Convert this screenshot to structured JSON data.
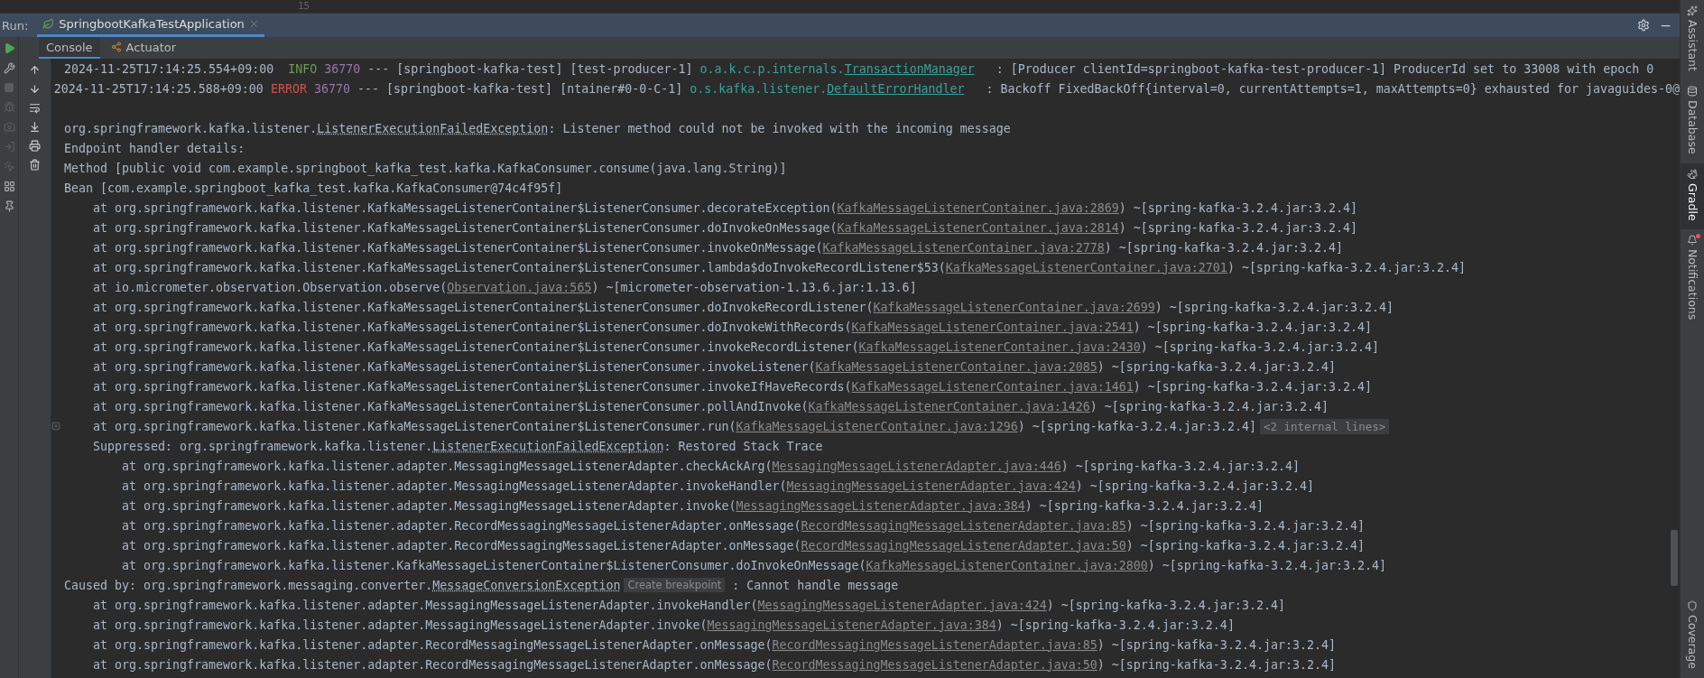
{
  "editor": {
    "line_number": "15"
  },
  "run_panel": {
    "label": "Run:",
    "tabs": [
      {
        "title": "SpringbootKafkaTestApplication",
        "selected": true
      }
    ]
  },
  "sub_tabs": [
    {
      "label": "Console",
      "selected": true
    },
    {
      "label": "Actuator",
      "selected": false
    }
  ],
  "right_toolbar": [
    {
      "label": "Assistant",
      "selected": false
    },
    {
      "label": "Database",
      "selected": false
    },
    {
      "label": "Gradle",
      "selected": true
    },
    {
      "label": "Notifications",
      "selected": false,
      "badge": true
    },
    {
      "label": "Coverage",
      "selected": false
    }
  ],
  "console": {
    "lines": [
      {
        "kind": "log",
        "segments": [
          {
            "kind": "text",
            "text": "2024-11-25T17:14:25.554+09:00  "
          },
          {
            "kind": "level-info",
            "text": "INFO"
          },
          {
            "kind": "pid",
            "text": " 36770"
          },
          {
            "kind": "text",
            "text": " --- [springboot-kafka-test] [test-producer-1] "
          },
          {
            "kind": "logger",
            "text": "o.a.k.c.p.internals."
          },
          {
            "kind": "class-link",
            "text": "TransactionManager"
          },
          {
            "kind": "text",
            "text": "   : [Producer clientId=springboot-kafka-test-producer-1] ProducerId set to 33008 with epoch 0"
          }
        ]
      },
      {
        "kind": "log",
        "segments": [
          {
            "kind": "text",
            "text": "2024-11-25T17:14:25.588+09:00 "
          },
          {
            "kind": "level-error",
            "text": "ERROR"
          },
          {
            "kind": "pid",
            "text": " 36770"
          },
          {
            "kind": "text",
            "text": " --- [springboot-kafka-test] [ntainer#0-0-C-1] "
          },
          {
            "kind": "logger",
            "text": "o.s.kafka.listener."
          },
          {
            "kind": "class-link",
            "text": "DefaultErrorHandler"
          },
          {
            "kind": "text",
            "text": "   : Backoff FixedBackOff{interval=0, currentAttempts=1, maxAttempts=0} exhausted for javaguides-0@"
          }
        ]
      },
      {
        "kind": "blank"
      },
      {
        "kind": "log",
        "segments": [
          {
            "kind": "text",
            "text": "org.springframework.kafka.listener."
          },
          {
            "kind": "type-link",
            "text": "ListenerExecutionFailedException"
          },
          {
            "kind": "text",
            "text": ": Listener method could not be invoked with the incoming message"
          }
        ]
      },
      {
        "kind": "log",
        "segments": [
          {
            "kind": "text",
            "text": "Endpoint handler details:"
          }
        ]
      },
      {
        "kind": "log",
        "segments": [
          {
            "kind": "text",
            "text": "Method [public void com.example.springboot_kafka_test.kafka.KafkaConsumer.consume(java.lang.String)]"
          }
        ]
      },
      {
        "kind": "log",
        "segments": [
          {
            "kind": "text",
            "text": "Bean [com.example.springboot_kafka_test.kafka.KafkaConsumer@74c4f95f]"
          }
        ]
      },
      {
        "kind": "frame",
        "segments": [
          {
            "kind": "text",
            "text": "at org.springframework.kafka.listener.KafkaMessageListenerContainer$ListenerConsumer.decorateException("
          },
          {
            "kind": "file-link",
            "text": "KafkaMessageListenerContainer.java:2869"
          },
          {
            "kind": "text",
            "text": ") ~[spring-kafka-3.2.4.jar:3.2.4]"
          }
        ]
      },
      {
        "kind": "frame",
        "segments": [
          {
            "kind": "text",
            "text": "at org.springframework.kafka.listener.KafkaMessageListenerContainer$ListenerConsumer.doInvokeOnMessage("
          },
          {
            "kind": "file-link",
            "text": "KafkaMessageListenerContainer.java:2814"
          },
          {
            "kind": "text",
            "text": ") ~[spring-kafka-3.2.4.jar:3.2.4]"
          }
        ]
      },
      {
        "kind": "frame",
        "segments": [
          {
            "kind": "text",
            "text": "at org.springframework.kafka.listener.KafkaMessageListenerContainer$ListenerConsumer.invokeOnMessage("
          },
          {
            "kind": "file-link",
            "text": "KafkaMessageListenerContainer.java:2778"
          },
          {
            "kind": "text",
            "text": ") ~[spring-kafka-3.2.4.jar:3.2.4]"
          }
        ]
      },
      {
        "kind": "frame",
        "segments": [
          {
            "kind": "text",
            "text": "at org.springframework.kafka.listener.KafkaMessageListenerContainer$ListenerConsumer.lambda$doInvokeRecordListener$53("
          },
          {
            "kind": "file-link",
            "text": "KafkaMessageListenerContainer.java:2701"
          },
          {
            "kind": "text",
            "text": ") ~[spring-kafka-3.2.4.jar:3.2.4]"
          }
        ]
      },
      {
        "kind": "frame",
        "segments": [
          {
            "kind": "text",
            "text": "at io.micrometer.observation.Observation.observe("
          },
          {
            "kind": "file-link",
            "text": "Observation.java:565"
          },
          {
            "kind": "text",
            "text": ") ~[micrometer-observation-1.13.6.jar:1.13.6]"
          }
        ]
      },
      {
        "kind": "frame",
        "segments": [
          {
            "kind": "text",
            "text": "at org.springframework.kafka.listener.KafkaMessageListenerContainer$ListenerConsumer.doInvokeRecordListener("
          },
          {
            "kind": "file-link",
            "text": "KafkaMessageListenerContainer.java:2699"
          },
          {
            "kind": "text",
            "text": ") ~[spring-kafka-3.2.4.jar:3.2.4]"
          }
        ]
      },
      {
        "kind": "frame",
        "segments": [
          {
            "kind": "text",
            "text": "at org.springframework.kafka.listener.KafkaMessageListenerContainer$ListenerConsumer.doInvokeWithRecords("
          },
          {
            "kind": "file-link",
            "text": "KafkaMessageListenerContainer.java:2541"
          },
          {
            "kind": "text",
            "text": ") ~[spring-kafka-3.2.4.jar:3.2.4]"
          }
        ]
      },
      {
        "kind": "frame",
        "segments": [
          {
            "kind": "text",
            "text": "at org.springframework.kafka.listener.KafkaMessageListenerContainer$ListenerConsumer.invokeRecordListener("
          },
          {
            "kind": "file-link",
            "text": "KafkaMessageListenerContainer.java:2430"
          },
          {
            "kind": "text",
            "text": ") ~[spring-kafka-3.2.4.jar:3.2.4]"
          }
        ]
      },
      {
        "kind": "frame",
        "segments": [
          {
            "kind": "text",
            "text": "at org.springframework.kafka.listener.KafkaMessageListenerContainer$ListenerConsumer.invokeListener("
          },
          {
            "kind": "file-link",
            "text": "KafkaMessageListenerContainer.java:2085"
          },
          {
            "kind": "text",
            "text": ") ~[spring-kafka-3.2.4.jar:3.2.4]"
          }
        ]
      },
      {
        "kind": "frame",
        "segments": [
          {
            "kind": "text",
            "text": "at org.springframework.kafka.listener.KafkaMessageListenerContainer$ListenerConsumer.invokeIfHaveRecords("
          },
          {
            "kind": "file-link",
            "text": "KafkaMessageListenerContainer.java:1461"
          },
          {
            "kind": "text",
            "text": ") ~[spring-kafka-3.2.4.jar:3.2.4]"
          }
        ]
      },
      {
        "kind": "frame",
        "segments": [
          {
            "kind": "text",
            "text": "at org.springframework.kafka.listener.KafkaMessageListenerContainer$ListenerConsumer.pollAndInvoke("
          },
          {
            "kind": "file-link",
            "text": "KafkaMessageListenerContainer.java:1426"
          },
          {
            "kind": "text",
            "text": ") ~[spring-kafka-3.2.4.jar:3.2.4]"
          }
        ]
      },
      {
        "kind": "frame",
        "foldable": true,
        "segments": [
          {
            "kind": "text",
            "text": "at org.springframework.kafka.listener.KafkaMessageListenerContainer$ListenerConsumer.run("
          },
          {
            "kind": "file-link",
            "text": "KafkaMessageListenerContainer.java:1296"
          },
          {
            "kind": "text",
            "text": ") ~[spring-kafka-3.2.4.jar:3.2.4]"
          },
          {
            "kind": "hint",
            "text": "<2 internal lines>"
          }
        ]
      },
      {
        "kind": "frame",
        "segments": [
          {
            "kind": "text",
            "text": "Suppressed: org.springframework.kafka.listener."
          },
          {
            "kind": "type-link",
            "text": "ListenerExecutionFailedException"
          },
          {
            "kind": "text",
            "text": ": Restored Stack Trace"
          }
        ]
      },
      {
        "kind": "nested-frame",
        "segments": [
          {
            "kind": "text",
            "text": "at org.springframework.kafka.listener.adapter.MessagingMessageListenerAdapter.checkAckArg("
          },
          {
            "kind": "file-link",
            "text": "MessagingMessageListenerAdapter.java:446"
          },
          {
            "kind": "text",
            "text": ") ~[spring-kafka-3.2.4.jar:3.2.4]"
          }
        ]
      },
      {
        "kind": "nested-frame",
        "segments": [
          {
            "kind": "text",
            "text": "at org.springframework.kafka.listener.adapter.MessagingMessageListenerAdapter.invokeHandler("
          },
          {
            "kind": "file-link",
            "text": "MessagingMessageListenerAdapter.java:424"
          },
          {
            "kind": "text",
            "text": ") ~[spring-kafka-3.2.4.jar:3.2.4]"
          }
        ]
      },
      {
        "kind": "nested-frame",
        "segments": [
          {
            "kind": "text",
            "text": "at org.springframework.kafka.listener.adapter.MessagingMessageListenerAdapter.invoke("
          },
          {
            "kind": "file-link",
            "text": "MessagingMessageListenerAdapter.java:384"
          },
          {
            "kind": "text",
            "text": ") ~[spring-kafka-3.2.4.jar:3.2.4]"
          }
        ]
      },
      {
        "kind": "nested-frame",
        "segments": [
          {
            "kind": "text",
            "text": "at org.springframework.kafka.listener.adapter.RecordMessagingMessageListenerAdapter.onMessage("
          },
          {
            "kind": "file-link",
            "text": "RecordMessagingMessageListenerAdapter.java:85"
          },
          {
            "kind": "text",
            "text": ") ~[spring-kafka-3.2.4.jar:3.2.4]"
          }
        ]
      },
      {
        "kind": "nested-frame",
        "segments": [
          {
            "kind": "text",
            "text": "at org.springframework.kafka.listener.adapter.RecordMessagingMessageListenerAdapter.onMessage("
          },
          {
            "kind": "file-link",
            "text": "RecordMessagingMessageListenerAdapter.java:50"
          },
          {
            "kind": "text",
            "text": ") ~[spring-kafka-3.2.4.jar:3.2.4]"
          }
        ]
      },
      {
        "kind": "nested-frame",
        "segments": [
          {
            "kind": "text",
            "text": "at org.springframework.kafka.listener.KafkaMessageListenerContainer$ListenerConsumer.doInvokeOnMessage("
          },
          {
            "kind": "file-link",
            "text": "KafkaMessageListenerContainer.java:2800"
          },
          {
            "kind": "text",
            "text": ") ~[spring-kafka-3.2.4.jar:3.2.4]"
          }
        ]
      },
      {
        "kind": "log",
        "segments": [
          {
            "kind": "text",
            "text": "Caused by: org.springframework.messaging.converter."
          },
          {
            "kind": "type-link",
            "text": "MessageConversionException"
          },
          {
            "kind": "hint",
            "text": "Create breakpoint"
          },
          {
            "kind": "text",
            "text": " : Cannot handle message"
          }
        ]
      },
      {
        "kind": "frame",
        "segments": [
          {
            "kind": "text",
            "text": "at org.springframework.kafka.listener.adapter.MessagingMessageListenerAdapter.invokeHandler("
          },
          {
            "kind": "file-link",
            "text": "MessagingMessageListenerAdapter.java:424"
          },
          {
            "kind": "text",
            "text": ") ~[spring-kafka-3.2.4.jar:3.2.4]"
          }
        ]
      },
      {
        "kind": "frame",
        "segments": [
          {
            "kind": "text",
            "text": "at org.springframework.kafka.listener.adapter.MessagingMessageListenerAdapter.invoke("
          },
          {
            "kind": "file-link",
            "text": "MessagingMessageListenerAdapter.java:384"
          },
          {
            "kind": "text",
            "text": ") ~[spring-kafka-3.2.4.jar:3.2.4]"
          }
        ]
      },
      {
        "kind": "frame",
        "segments": [
          {
            "kind": "text",
            "text": "at org.springframework.kafka.listener.adapter.RecordMessagingMessageListenerAdapter.onMessage("
          },
          {
            "kind": "file-link",
            "text": "RecordMessagingMessageListenerAdapter.java:85"
          },
          {
            "kind": "text",
            "text": ") ~[spring-kafka-3.2.4.jar:3.2.4]"
          }
        ]
      },
      {
        "kind": "frame",
        "segments": [
          {
            "kind": "text",
            "text": "at org.springframework.kafka.listener.adapter.RecordMessagingMessageListenerAdapter.onMessage("
          },
          {
            "kind": "file-link",
            "text": "RecordMessagingMessageListenerAdapter.java:50"
          },
          {
            "kind": "text",
            "text": ") ~[spring-kafka-3.2.4.jar:3.2.4]"
          }
        ]
      }
    ]
  }
}
